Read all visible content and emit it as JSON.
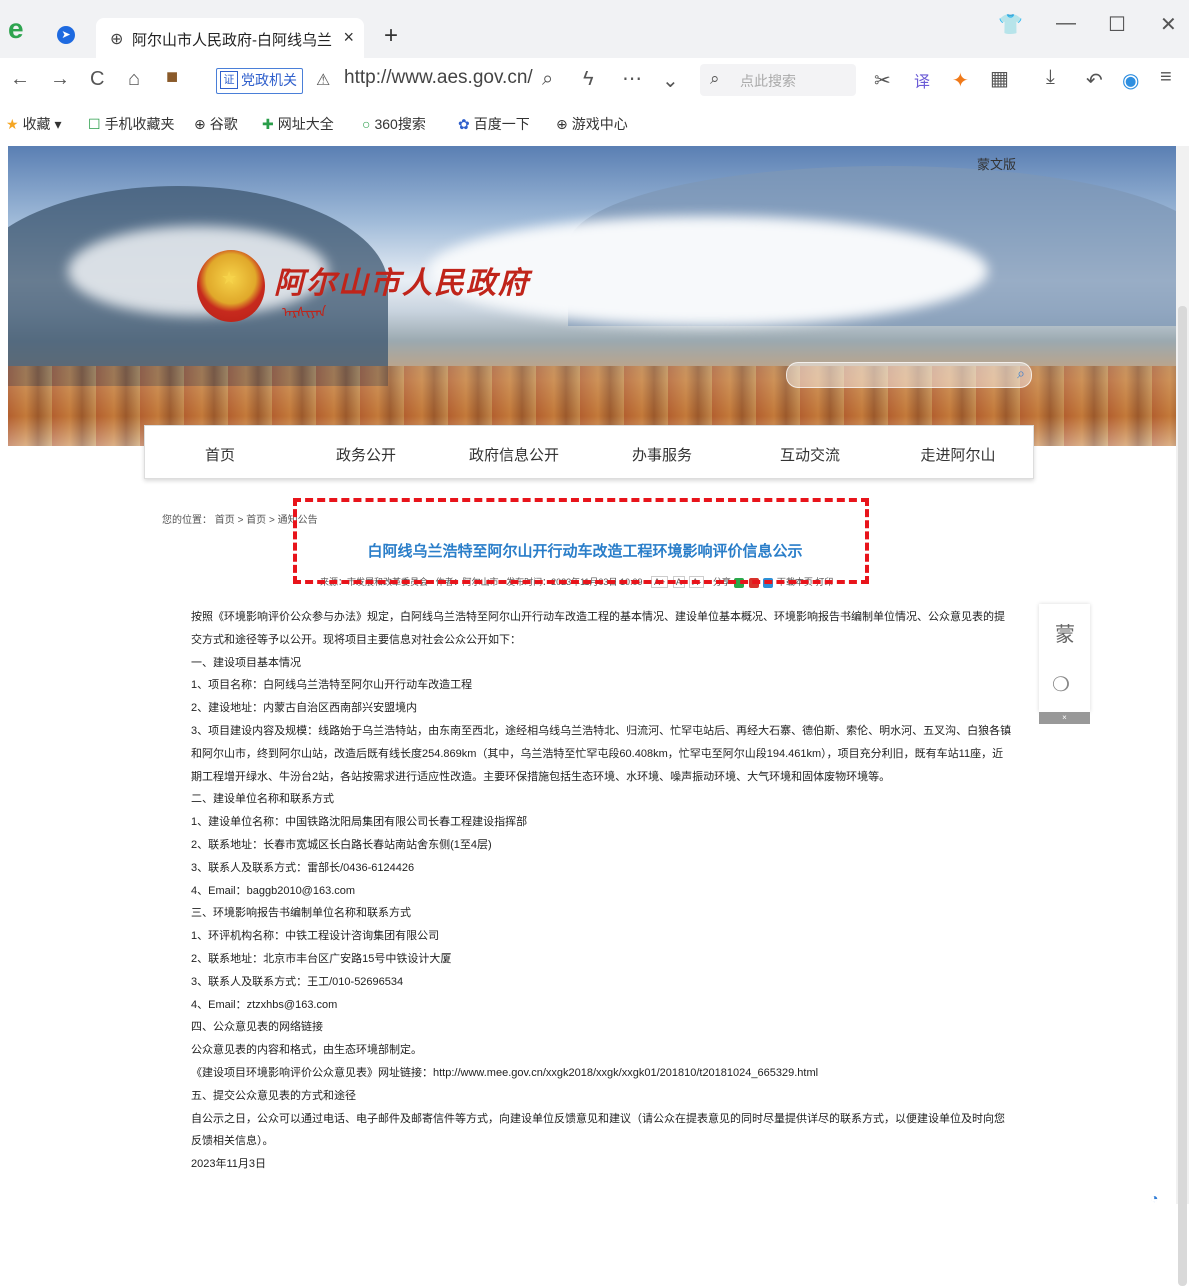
{
  "browser": {
    "tab_title": "阿尔山市人民政府-白阿线乌兰",
    "tab_close": "×",
    "new_tab": "+",
    "gov_label": "党政机关",
    "url": "http://www.aes.gov.cn/",
    "search_placeholder": "点此搜索"
  },
  "bookmarks": [
    {
      "icon": "★",
      "label": "收藏"
    },
    {
      "icon": "☐",
      "label": "手机收藏夹"
    },
    {
      "icon": "⊕",
      "label": "谷歌"
    },
    {
      "icon": "✚",
      "label": "网址大全"
    },
    {
      "icon": "○",
      "label": "360搜索"
    },
    {
      "icon": "✿",
      "label": "百度一下"
    },
    {
      "icon": "⊕",
      "label": "游戏中心"
    }
  ],
  "site": {
    "mongolian_version": "蒙文版",
    "gov_name": "阿尔山市人民政府",
    "mongolian_script": "ᠠᠷᠰᠢᠶᠠᠨ"
  },
  "menu": [
    "首页",
    "政务公开",
    "政府信息公开",
    "办事服务",
    "互动交流",
    "走进阿尔山"
  ],
  "breadcrumb": {
    "label": "您的位置：",
    "home1": "首页",
    "home2": "首页",
    "current": "通知公告",
    "sep": ">"
  },
  "article": {
    "title": "白阿线乌兰浩特至阿尔山开行动车改造工程环境影响评价信息公示",
    "source": "来源：市发展和改革委员会",
    "author": "作者：阿尔山市",
    "published": "发布时间：2023年11月03日 10:09",
    "font_big": "A+",
    "font_mid": "A",
    "font_small": "A-",
    "share": "分享",
    "download": "下载本页",
    "print": "打印",
    "paragraphs": [
      "按照《环境影响评价公众参与办法》规定，白阿线乌兰浩特至阿尔山开行动车改造工程的基本情况、建设单位基本概况、环境影响报告书编制单位情况、公众意见表的提交方式和途径等予以公开。现将项目主要信息对社会公众公开如下：",
      "一、建设项目基本情况",
      "1、项目名称：白阿线乌兰浩特至阿尔山开行动车改造工程",
      "2、建设地址：内蒙古自治区西南部兴安盟境内",
      "3、项目建设内容及规模：线路始于乌兰浩特站，由东南至西北，途经相乌线乌兰浩特北、归流河、忙罕屯站后、再经大石寨、德伯斯、索伦、明水河、五叉沟、白狼各镇和阿尔山市，终到阿尔山站，改造后既有线长度254.869km（其中，乌兰浩特至忙罕屯段60.408km，忙罕屯至阿尔山段194.461km），项目充分利旧，既有车站11座，近期工程增开绿水、牛汾台2站，各站按需求进行适应性改造。主要环保措施包括生态环境、水环境、噪声振动环境、大气环境和固体废物环境等。",
      "二、建设单位名称和联系方式",
      "1、建设单位名称：中国铁路沈阳局集团有限公司长春工程建设指挥部",
      "2、联系地址：长春市宽城区长白路长春站南站舍东侧(1至4层)",
      "3、联系人及联系方式：雷部长/0436-6124426",
      "4、Email：baggb2010@163.com",
      "三、环境影响报告书编制单位名称和联系方式",
      "1、环评机构名称：中铁工程设计咨询集团有限公司",
      "2、联系地址：北京市丰台区广安路15号中铁设计大厦",
      "3、联系人及联系方式：王工/010-52696534",
      "4、Email：ztzxhbs@163.com",
      "四、公众意见表的网络链接",
      "公众意见表的内容和格式，由生态环境部制定。",
      "《建设项目环境影响评价公众意见表》网址链接：http://www.mee.gov.cn/xxgk2018/xxgk/xxgk01/201810/t20181024_665329.html",
      "五、提交公众意见表的方式和途径",
      "自公示之日，公众可以通过电话、电子邮件及邮寄信件等方式，向建设单位反馈意见和建议（请公众在提表意见的同时尽量提供详尽的联系方式，以便建设单位及时向您反馈相关信息）。",
      "2023年11月3日"
    ]
  },
  "side_float": {
    "mongolian": "蒙",
    "close": "×"
  },
  "colors": {
    "title_blue": "#2a7ec9",
    "dash_red": "#e8141b",
    "emblem_red": "#c0241a"
  }
}
